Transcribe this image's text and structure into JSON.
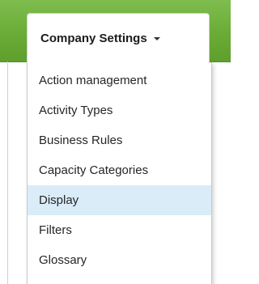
{
  "nav": {
    "label": "Company Settings",
    "caret_icon": "chevron-down-icon",
    "bar_color": "#6aac36"
  },
  "menu": {
    "highlight_color": "#d9ecf8",
    "items": [
      {
        "label": "Action management",
        "active": false
      },
      {
        "label": "Activity Types",
        "active": false
      },
      {
        "label": "Business Rules",
        "active": false
      },
      {
        "label": "Capacity Categories",
        "active": false
      },
      {
        "label": "Display",
        "active": true
      },
      {
        "label": "Filters",
        "active": false
      },
      {
        "label": "Glossary",
        "active": false
      }
    ]
  }
}
